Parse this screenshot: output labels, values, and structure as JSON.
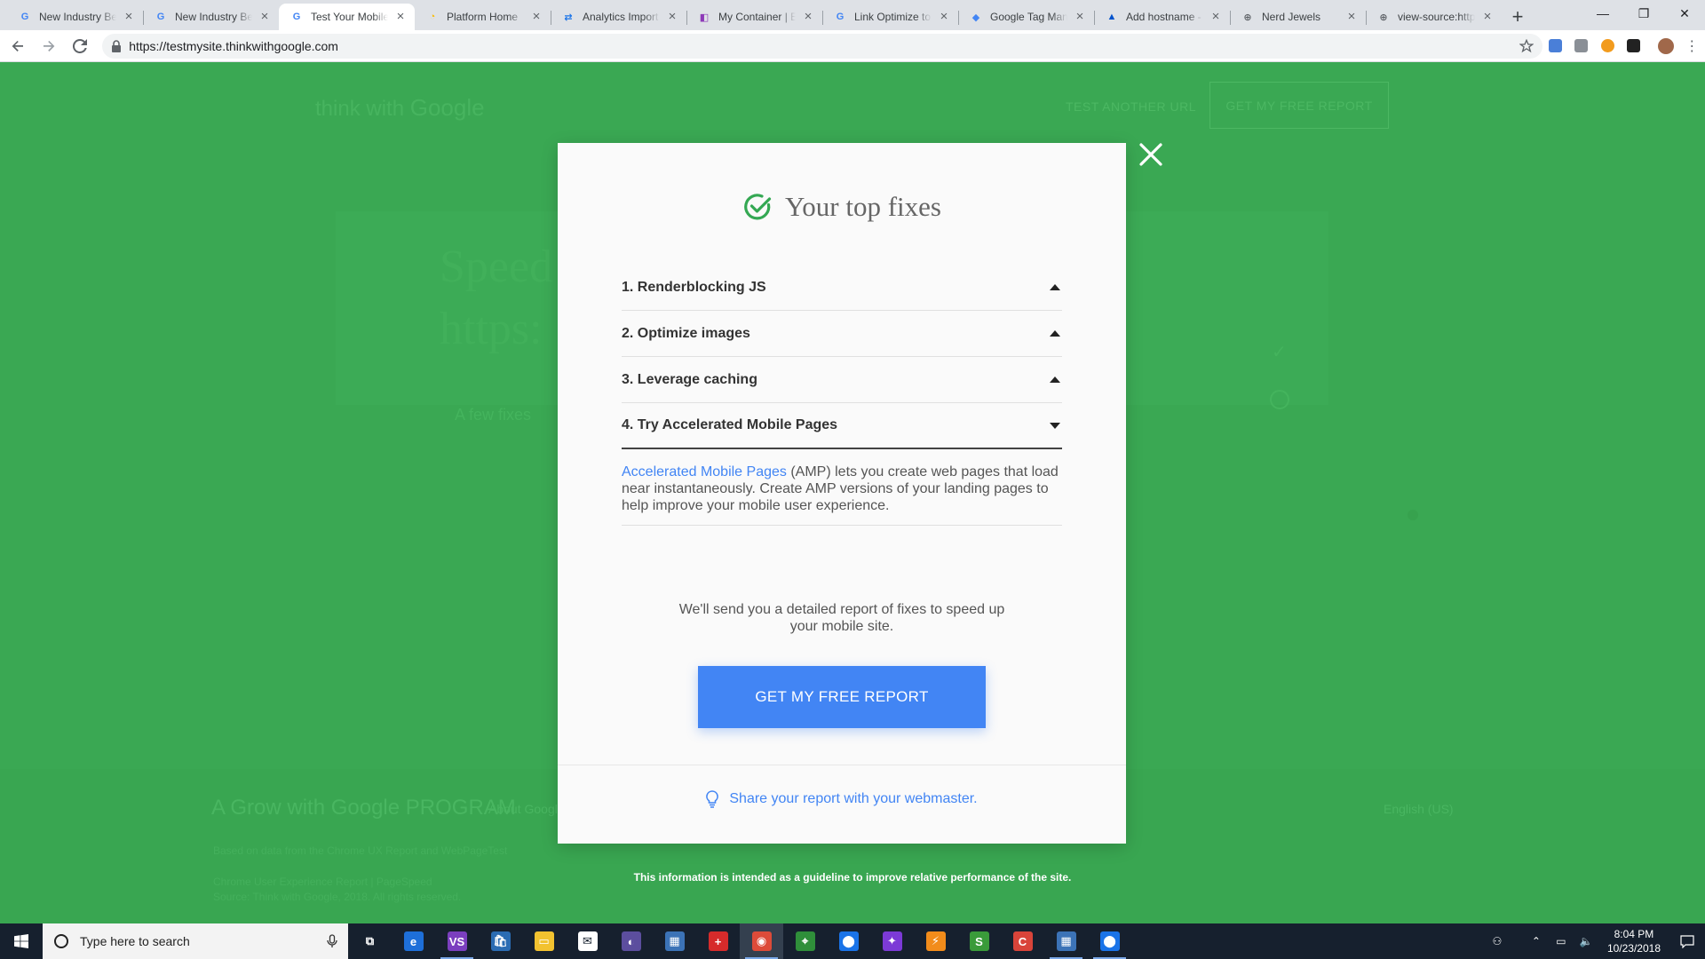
{
  "browser": {
    "tabs": [
      {
        "title": "New Industry Be",
        "favicon": "google-g-icon",
        "active": false
      },
      {
        "title": "New Industry Be",
        "favicon": "google-g-icon",
        "active": false
      },
      {
        "title": "Test Your Mobile",
        "favicon": "google-g-icon",
        "active": true
      },
      {
        "title": "Platform Home",
        "favicon": "google-marketing-platform-icon",
        "active": false
      },
      {
        "title": "Analytics Import",
        "favicon": "analytics-import-icon",
        "active": false
      },
      {
        "title": "My Container | E",
        "favicon": "tag-container-icon",
        "active": false
      },
      {
        "title": "Link Optimize to",
        "favicon": "google-g-icon",
        "active": false
      },
      {
        "title": "Google Tag Man",
        "favicon": "tag-manager-icon",
        "active": false
      },
      {
        "title": "Add hostname -",
        "favicon": "atlassian-icon",
        "active": false
      },
      {
        "title": "Nerd Jewels",
        "favicon": "web-globe-icon",
        "active": false
      },
      {
        "title": "view-source:http",
        "favicon": "web-globe-icon",
        "active": false
      }
    ],
    "new_tab_symbol": "+",
    "window_controls": {
      "minimize": "—",
      "maximize": "❐",
      "close": "✕"
    },
    "url": "https://testmysite.thinkwithgoogle.com"
  },
  "background_page": {
    "logo_prefix": "think with ",
    "logo_brand": "Google",
    "nav_link": "TEST ANOTHER URL",
    "nav_button": "GET MY FREE REPORT",
    "heading_line1": "Speed",
    "heading_line2": "https:",
    "subtext": "A few fixes",
    "footer_brand": "A Grow with Google PROGRAM",
    "footer_about": "About Google",
    "footer_lang": "English (US)",
    "footer_fine1": "Based on data from the Chrome UX Report and WebPageTest",
    "footer_fine2": "Chrome User Experience Report | PageSpeed",
    "footer_fine3": "Source: Think with Google, 2018. All rights reserved."
  },
  "modal": {
    "title": "Your top fixes",
    "fixes": [
      {
        "label": "1. Renderblocking JS",
        "expanded": false
      },
      {
        "label": "2. Optimize images",
        "expanded": false
      },
      {
        "label": "3. Leverage caching",
        "expanded": false
      },
      {
        "label": "4. Try Accelerated Mobile Pages",
        "expanded": true
      }
    ],
    "expanded_fix": {
      "link_text": "Accelerated Mobile Pages",
      "body_text": " (AMP) lets you create web pages that load near instantaneously. Create AMP versions of your landing pages to help improve your mobile user experience."
    },
    "report_note": "We'll send you a detailed report of fixes to speed up your mobile site.",
    "cta_label": "GET MY FREE REPORT",
    "share_text": "Share your report with your webmaster."
  },
  "disclaimer": "This information is intended as a guideline to improve relative performance of the site.",
  "taskbar": {
    "search_placeholder": "Type here to search",
    "apps": [
      {
        "name": "task-view-icon",
        "color": "#16202e",
        "glyph": "⧉",
        "running": false,
        "active": false
      },
      {
        "name": "edge-browser-icon",
        "color": "#1e6fd9",
        "glyph": "e",
        "running": false,
        "active": false
      },
      {
        "name": "visual-studio-icon",
        "color": "#7b3fbf",
        "glyph": "VS",
        "running": true,
        "active": false
      },
      {
        "name": "store-icon",
        "color": "#2b6cb3",
        "glyph": "🛍",
        "running": false,
        "active": false
      },
      {
        "name": "file-explorer-icon",
        "color": "#f2c230",
        "glyph": "▭",
        "running": false,
        "active": false
      },
      {
        "name": "mail-icon",
        "color": "#ffffff",
        "glyph": "✉",
        "running": false,
        "active": false
      },
      {
        "name": "media-app-icon",
        "color": "#5c4e9e",
        "glyph": "◐",
        "running": false,
        "active": false
      },
      {
        "name": "remote-desktop-icon",
        "color": "#3c73b7",
        "glyph": "▦",
        "running": false,
        "active": false
      },
      {
        "name": "swiss-app-icon",
        "color": "#d62b2b",
        "glyph": "+",
        "running": false,
        "active": false
      },
      {
        "name": "chrome-icon",
        "color": "#dd4b39",
        "glyph": "◉",
        "running": true,
        "active": true
      },
      {
        "name": "maps-pin-icon",
        "color": "#2f8f3a",
        "glyph": "⌖",
        "running": false,
        "active": false
      },
      {
        "name": "location-icon",
        "color": "#1a73e8",
        "glyph": "⬤",
        "running": false,
        "active": false
      },
      {
        "name": "purple-app-icon",
        "color": "#7c3ad6",
        "glyph": "✦",
        "running": false,
        "active": false
      },
      {
        "name": "orange-app-icon",
        "color": "#f28c1b",
        "glyph": "⚡",
        "running": false,
        "active": false
      },
      {
        "name": "python-icon",
        "color": "#3a9b3a",
        "glyph": "S",
        "running": false,
        "active": false
      },
      {
        "name": "red-app-icon",
        "color": "#d9443a",
        "glyph": "C",
        "running": false,
        "active": false
      },
      {
        "name": "window-app-icon",
        "color": "#3c73b7",
        "glyph": "▦",
        "running": true,
        "active": false
      },
      {
        "name": "pin-app-icon",
        "color": "#1a73e8",
        "glyph": "⬤",
        "running": true,
        "active": false
      }
    ],
    "time": "8:04 PM",
    "date": "10/23/2018"
  },
  "colors": {
    "page_green": "#3aa853",
    "accent_blue": "#4285f4",
    "check_green": "#34a853"
  }
}
